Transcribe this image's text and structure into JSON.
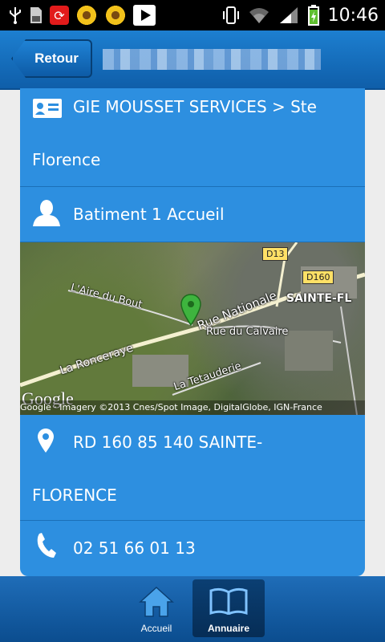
{
  "status_bar": {
    "time": "10:46"
  },
  "header": {
    "back_label": "Retour"
  },
  "details": {
    "company_line1": "GIE MOUSSET SERVICES > Ste",
    "company_line2": "Florence",
    "contact": "Batiment 1 Accueil",
    "address_line1": "RD 160 85 140 SAINTE-",
    "address_line2": "FLORENCE",
    "phone": "02 51 66 01 13"
  },
  "map": {
    "labels": {
      "d13": "D13",
      "d160": "D160",
      "sainte": "SAINTE-FL",
      "aire": "L'Aire du Bout",
      "rue_nationale": "Rue Nationale",
      "rue_calvaire": "Rue du Calvaire",
      "ronceraye": "La Ronceraye",
      "tetauderie": "La Tetauderie"
    },
    "google": "Google",
    "attribution": "Google · Imagery ©2013 Cnes/Spot Image, DigitalGlobe, IGN-France"
  },
  "tabs": [
    {
      "label": "Accueil",
      "icon": "home-icon"
    },
    {
      "label": "Annuaire",
      "icon": "book-icon"
    }
  ],
  "colors": {
    "header": "#1d7fd0",
    "card": "#2d8fe0",
    "tabbar": "#1f6db8"
  }
}
